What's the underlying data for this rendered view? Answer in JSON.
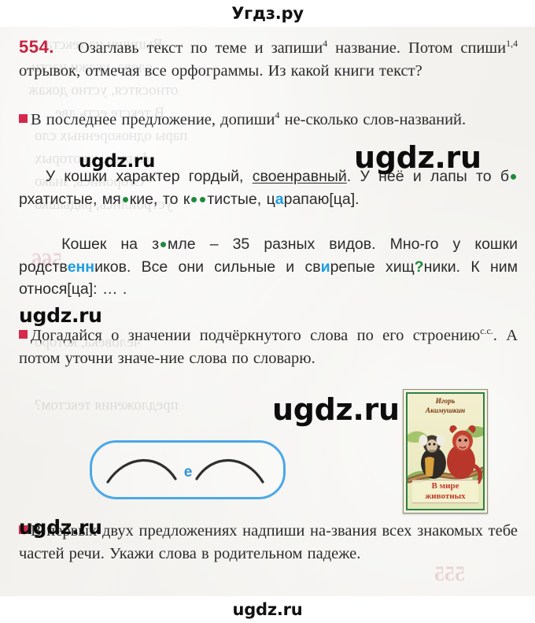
{
  "watermarks": {
    "header": "Угдз.ру",
    "footer": "ugdz.ru",
    "body": [
      "ugdz.ru",
      "ugdz.ru",
      "ugdz.ru",
      "ugdz.ru",
      "ugdz.ru"
    ]
  },
  "exercise": {
    "number": "554.",
    "number_color": "#c8213f",
    "task_text": "Озаглавь текст по теме и запиши⁴ название. Потом спиши¹,⁴ отрывок, отмечая все орфограммы. Из какой книги текст?",
    "bullet_color": "#d6284b",
    "bullet1": "В последнее предложение, допиши⁴ несколько слов-названий.",
    "bullet2": "Догадайся о значении подчёркнутого слова по его строению с.с.. А потом уточни значение слова по словарю.",
    "bullet3": "В первых двух предложениях надпиши названия всех знакомых тебе частей речи. Укажи слова в родительном падеже."
  },
  "excerpt": {
    "paragraph1": "У кошки характер гордый, своенравный. У неё и лапы то б•рхатистые, мя•кие, то к••тистые, цaрапаю[ца].",
    "paragraph2": "Кошек на з•мле – 35 разных видов. Много у кошки родственников. Все они сильные и свирепые хищ?ники. К ним относя[ца]: ... .",
    "underlined_word": "своенравный",
    "number_in_text": "35",
    "missing_letter_dot_color": "#1f8a3b",
    "filled_letter_color": "#1d9de0",
    "filled_letters": [
      "a",
      "енн",
      "и"
    ],
    "question_mark": "?",
    "bracketed": [
      "[ца]",
      "[ца]"
    ]
  },
  "scheme": {
    "connector_letter": "е",
    "connector_color": "#2a93dd",
    "border_color": "#4aa8e8",
    "roots": 2
  },
  "book_cover": {
    "author_line1": "Игорь",
    "author_line2": "Акимушкин",
    "title_line1": "В мире",
    "title_line2": "животных",
    "author_color": "#7a3b14",
    "title_color": "#c0392b",
    "frame_color": "#2e7d4f"
  },
  "ghost_text": {
    "lines": [
      "Выпиши из текста",
      "слова, укажи части",
      "относятся, устно докаж",
      "В тексте есть две",
      "пары однокоренных сло",
      "формы, у которых",
      "Сторонись, знако",
      "устроились, рядышко",
      "человека, которо",
      "предложения текстом?"
    ]
  }
}
